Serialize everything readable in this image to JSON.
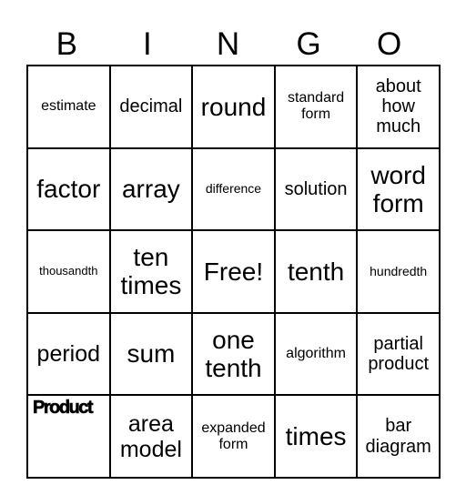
{
  "header": {
    "letters": [
      "B",
      "I",
      "N",
      "G",
      "O"
    ]
  },
  "board": {
    "rows": [
      [
        "estimate",
        "decimal",
        "round",
        "standard form",
        "about how much"
      ],
      [
        "factor",
        "array",
        "difference",
        "solution",
        "word form"
      ],
      [
        "thousandth",
        "ten times",
        "Free!",
        "tenth",
        "hundredth"
      ],
      [
        "period",
        "sum",
        "one tenth",
        "algorithm",
        "partial product"
      ],
      [
        "Product",
        "area model",
        "expanded form",
        "times",
        "bar diagram"
      ]
    ]
  }
}
